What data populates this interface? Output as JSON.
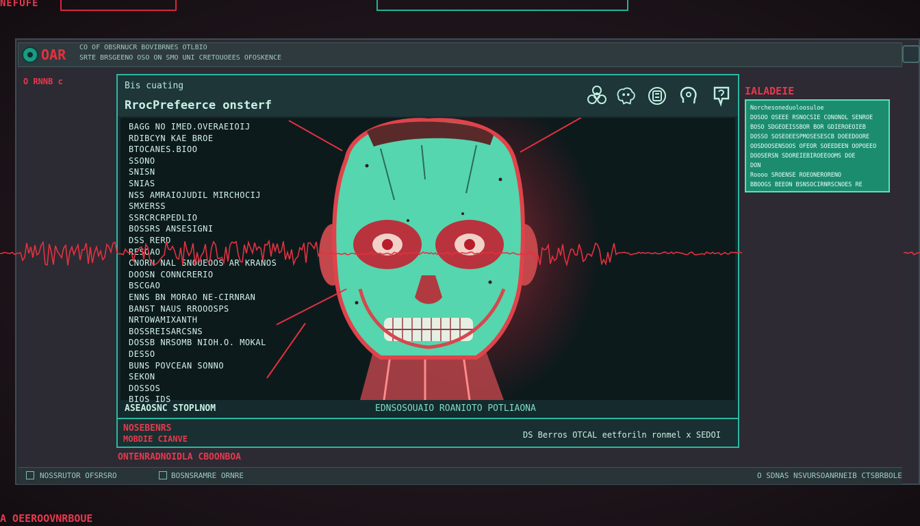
{
  "colors": {
    "accent_red": "#e53a4e",
    "accent_teal": "#2bb9a2",
    "panel_green": "#1c8c6f"
  },
  "top": {
    "left_label": "NEFUFE"
  },
  "titlebar": {
    "app_name": "OAR",
    "line1": "CO OF OBSRNUCR BOVIBRNES OTLBIO",
    "line2": "SRTE BRSGEENO OSO ON SMO UNI CRETOUOEES OFOSKENCE"
  },
  "left_panel": {
    "header": "O RNNB c"
  },
  "main": {
    "subtitle": "Bis cuating",
    "title": "RrocPrefeerce onsterf",
    "icons": [
      "biohazard-icon",
      "brain-icon",
      "chip-icon",
      "head-profile-icon",
      "tag-icon"
    ],
    "data_lines": [
      "BAGG NO  IMED.OVERAEIOIJ",
      "RDIBCYN  KAE BROE",
      "BTOCANES.BIOO",
      "SSONO",
      "SNISN",
      "SNIAS",
      "NSS  AMRAIOJUDIL  MIRCHOCIJ",
      "SMXERSS",
      "SSRCRCRPEDLIO",
      "BOSSRS ANSESIGNI",
      "DSS RERD",
      "RESOAO",
      "CNORN NAL  SNOUEOOS AR KRANOS",
      "DOOSN CONNCRERIO",
      "BSCGAO",
      "ENNS BN MORAO NE-CIRNRAN",
      "BANST NAUS  RROOOSPS",
      "NRTOWAMIXANTH",
      "BOSSREISARCSNS",
      "DOSSB NRSOMB NIOH.O. MOKAL",
      "DESSO",
      "BUNS POVCEAN SONNO",
      "SEKON",
      "DOSSOS",
      "BIOS IDS"
    ],
    "viewport_footer_left": "ASEAOSNC STOPLNOM",
    "viewport_footer_center": "EDNSOSOUAIO ROANIOTO POTLIAONA",
    "footer_red_1": "NOSEBENRS",
    "footer_red_2": "MOBDIE CIANVE",
    "footer_right": "DS  Berros  OTCAL  eetforiln  ronmel  x  SEDOI",
    "under_label": "ONTENRADNOIDLA CBOONBOA"
  },
  "right_panel": {
    "header": "IALADEIE",
    "info_lines": [
      "Norchesoneduoloosuloe",
      "DOSOO  OSEEE  RSNOCSIE  CONONOL SENROE",
      "BOSO  SDGEOEISSBOR  BOR  GDIEROEOIEB",
      "DOSSO  SOSEOEESPMOSESESCB  DOEEDOORE",
      "OOSDOOSENSOOS  OFEOR  SOEEDEEN  OOPOEEO",
      "DOOSERSN  SDOREIEBIROEEOOMS  DOE",
      "DON",
      "Roooo  SROENSE  ROEONERORENO",
      "BBOOGS  BEEON  BSNSOCIRNRSCNOES  RE"
    ]
  },
  "statusbar": {
    "left_text": "NOSSRUTOR  OFSRSRO",
    "middle_text": "BOSNSRAMRE ORNRE",
    "right_text": "O SDNAS  NSVURSOANRNEIB CTSBRBOLE"
  },
  "bottom_label": "A OEEROOVNRBOUE"
}
